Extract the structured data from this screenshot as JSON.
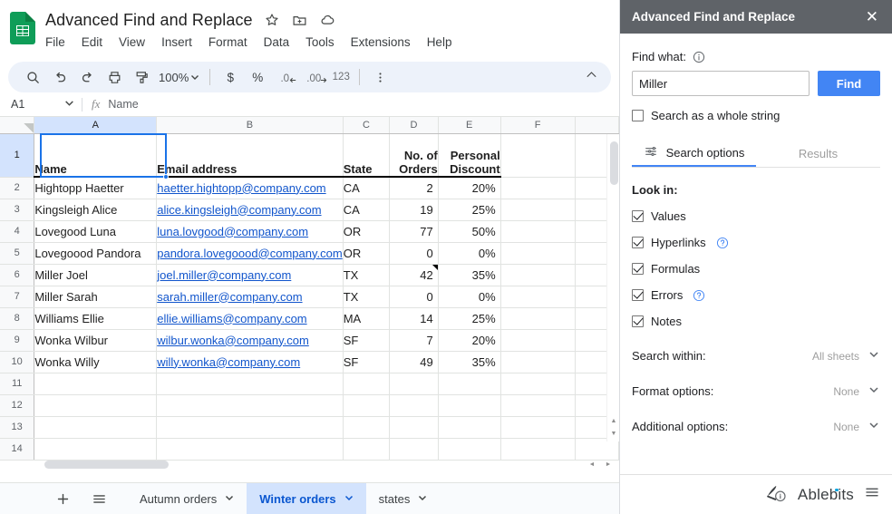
{
  "app": {
    "doc_title": "Advanced Find and Replace",
    "doc_icon": "sheets-icon",
    "title_icons": [
      "star-icon",
      "move-to-folder-icon",
      "cloud-saved-icon"
    ],
    "menu": [
      "File",
      "Edit",
      "View",
      "Insert",
      "Format",
      "Data",
      "Tools",
      "Extensions",
      "Help"
    ]
  },
  "toolbar": {
    "search": "search-icon",
    "undo": "undo-icon",
    "redo": "redo-icon",
    "print": "print-icon",
    "paint_format": "paint-format-icon",
    "zoom_value": "100%",
    "currency": "$",
    "percent": "%",
    "decrease_decimal": ".0",
    "increase_decimal": ".00",
    "number_format": "123",
    "more": "more-vertical-icon",
    "collapse": "chevron-up-icon"
  },
  "formula_bar": {
    "name_box": "A1",
    "fx": "fx",
    "content": "Name"
  },
  "grid": {
    "columns": [
      "A",
      "B",
      "C",
      "D",
      "E",
      "F"
    ],
    "selected_column": "A",
    "selected_row": "1",
    "selected_cell": "A1",
    "headers": [
      "Name",
      "Email address",
      "State",
      "No. of Orders",
      "Personal Discount"
    ],
    "rows": [
      {
        "n": "2",
        "name": "Hightopp Haetter",
        "email": "haetter.hightopp@company.com",
        "state": "CA",
        "orders": "2",
        "discount": "20%"
      },
      {
        "n": "3",
        "name": "Kingsleigh Alice",
        "email": "alice.kingsleigh@company.com",
        "state": "CA",
        "orders": "19",
        "discount": "25%"
      },
      {
        "n": "4",
        "name": "Lovegood Luna",
        "email": "luna.lovgood@company.com",
        "state": "OR",
        "orders": "77",
        "discount": "50%"
      },
      {
        "n": "5",
        "name": "Lovegoood Pandora",
        "email": "pandora.lovegoood@company.com",
        "state": "OR",
        "orders": "0",
        "discount": "0%"
      },
      {
        "n": "6",
        "name": "Miller Joel",
        "email": "joel.miller@company.com",
        "state": "TX",
        "orders": "42",
        "discount": "35%",
        "note": true
      },
      {
        "n": "7",
        "name": "Miller Sarah",
        "email": "sarah.miller@company.com",
        "state": "TX",
        "orders": "0",
        "discount": "0%"
      },
      {
        "n": "8",
        "name": "Williams Ellie",
        "email": "ellie.williams@company.com",
        "state": "MA",
        "orders": "14",
        "discount": "25%"
      },
      {
        "n": "9",
        "name": "Wonka Wilbur",
        "email": "wilbur.wonka@company.com",
        "state": "SF",
        "orders": "7",
        "discount": "20%"
      },
      {
        "n": "10",
        "name": "Wonka Willy",
        "email": "willy.wonka@company.com",
        "state": "SF",
        "orders": "49",
        "discount": "35%"
      }
    ],
    "empty_rows": [
      "11",
      "12",
      "13",
      "14"
    ]
  },
  "sheet_bar": {
    "add": "plus-icon",
    "all_sheets": "all-sheets-icon",
    "tabs": [
      {
        "label": "Autumn orders",
        "active": false
      },
      {
        "label": "Winter orders",
        "active": true
      },
      {
        "label": "states",
        "active": false
      }
    ]
  },
  "panel": {
    "title": "Advanced Find and Replace",
    "close": "✕",
    "find_label": "Find what:",
    "find_value": "Miller",
    "find_placeholder": "Find what",
    "find_button": "Find",
    "whole_string_label": "Search as a whole string",
    "whole_string_checked": false,
    "tabs": [
      {
        "label": "Search options",
        "active": true
      },
      {
        "label": "Results",
        "active": false
      }
    ],
    "look_in_title": "Look in:",
    "look_in": [
      {
        "label": "Values",
        "checked": true,
        "help": false
      },
      {
        "label": "Hyperlinks",
        "checked": true,
        "help": true
      },
      {
        "label": "Formulas",
        "checked": true,
        "help": false
      },
      {
        "label": "Errors",
        "checked": true,
        "help": true
      },
      {
        "label": "Notes",
        "checked": true,
        "help": false
      }
    ],
    "options": [
      {
        "label": "Search within:",
        "value": "All sheets"
      },
      {
        "label": "Format options:",
        "value": "None"
      },
      {
        "label": "Additional options:",
        "value": "None"
      }
    ],
    "footer_brand": "Ablebits",
    "footer_menu": "hamburger-icon"
  },
  "colors": {
    "sheets_green": "#0f9d58",
    "accent_blue": "#4285f4",
    "link_blue": "#1155cc",
    "panel_header": "#5f6368",
    "selection_blue": "#1a73e8",
    "tab_active_bg": "#d3e3fd",
    "brand_dot": "#00a3e0"
  }
}
